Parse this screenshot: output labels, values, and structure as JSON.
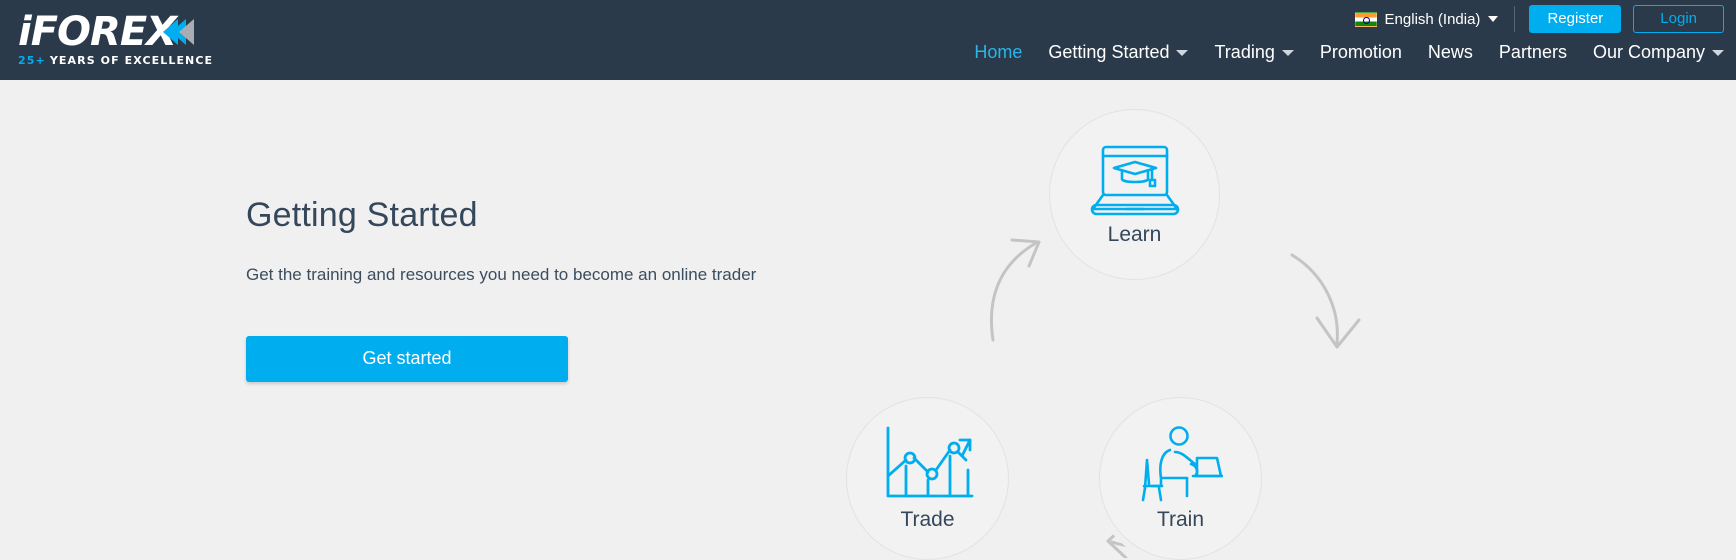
{
  "header": {
    "logo": {
      "word": "iFOREX",
      "tagline_years": "25+",
      "tagline_text": "YEARS OF EXCELLENCE"
    },
    "language": {
      "label": "English (India)",
      "flag_icon": "india-flag-icon",
      "caret_icon": "chevron-down-icon"
    },
    "register_label": "Register",
    "login_label": "Login",
    "nav": [
      {
        "label": "Home",
        "active": true,
        "has_caret": false
      },
      {
        "label": "Getting Started",
        "active": false,
        "has_caret": true
      },
      {
        "label": "Trading",
        "active": false,
        "has_caret": true
      },
      {
        "label": "Promotion",
        "active": false,
        "has_caret": false
      },
      {
        "label": "News",
        "active": false,
        "has_caret": false
      },
      {
        "label": "Partners",
        "active": false,
        "has_caret": false
      },
      {
        "label": "Our Company",
        "active": false,
        "has_caret": true
      }
    ]
  },
  "main": {
    "title": "Getting Started",
    "subtitle": "Get the training and resources you need to become an online trader",
    "cta_label": "Get started"
  },
  "cycle": {
    "nodes": [
      {
        "label": "Learn",
        "icon": "laptop-graduation-cap-icon"
      },
      {
        "label": "Train",
        "icon": "person-at-laptop-icon"
      },
      {
        "label": "Trade",
        "icon": "chart-uptrend-icon"
      }
    ],
    "arrows": [
      {
        "name": "arrow-trade-to-learn",
        "direction": "up-right"
      },
      {
        "name": "arrow-learn-to-train",
        "direction": "down"
      },
      {
        "name": "arrow-train-to-trade",
        "direction": "left"
      }
    ]
  },
  "colors": {
    "accent": "#00aeef",
    "header_bg": "#2b3a4b",
    "page_bg": "#f0f0f0",
    "text": "#35475a",
    "arrow_gray": "#c4c4c4"
  }
}
